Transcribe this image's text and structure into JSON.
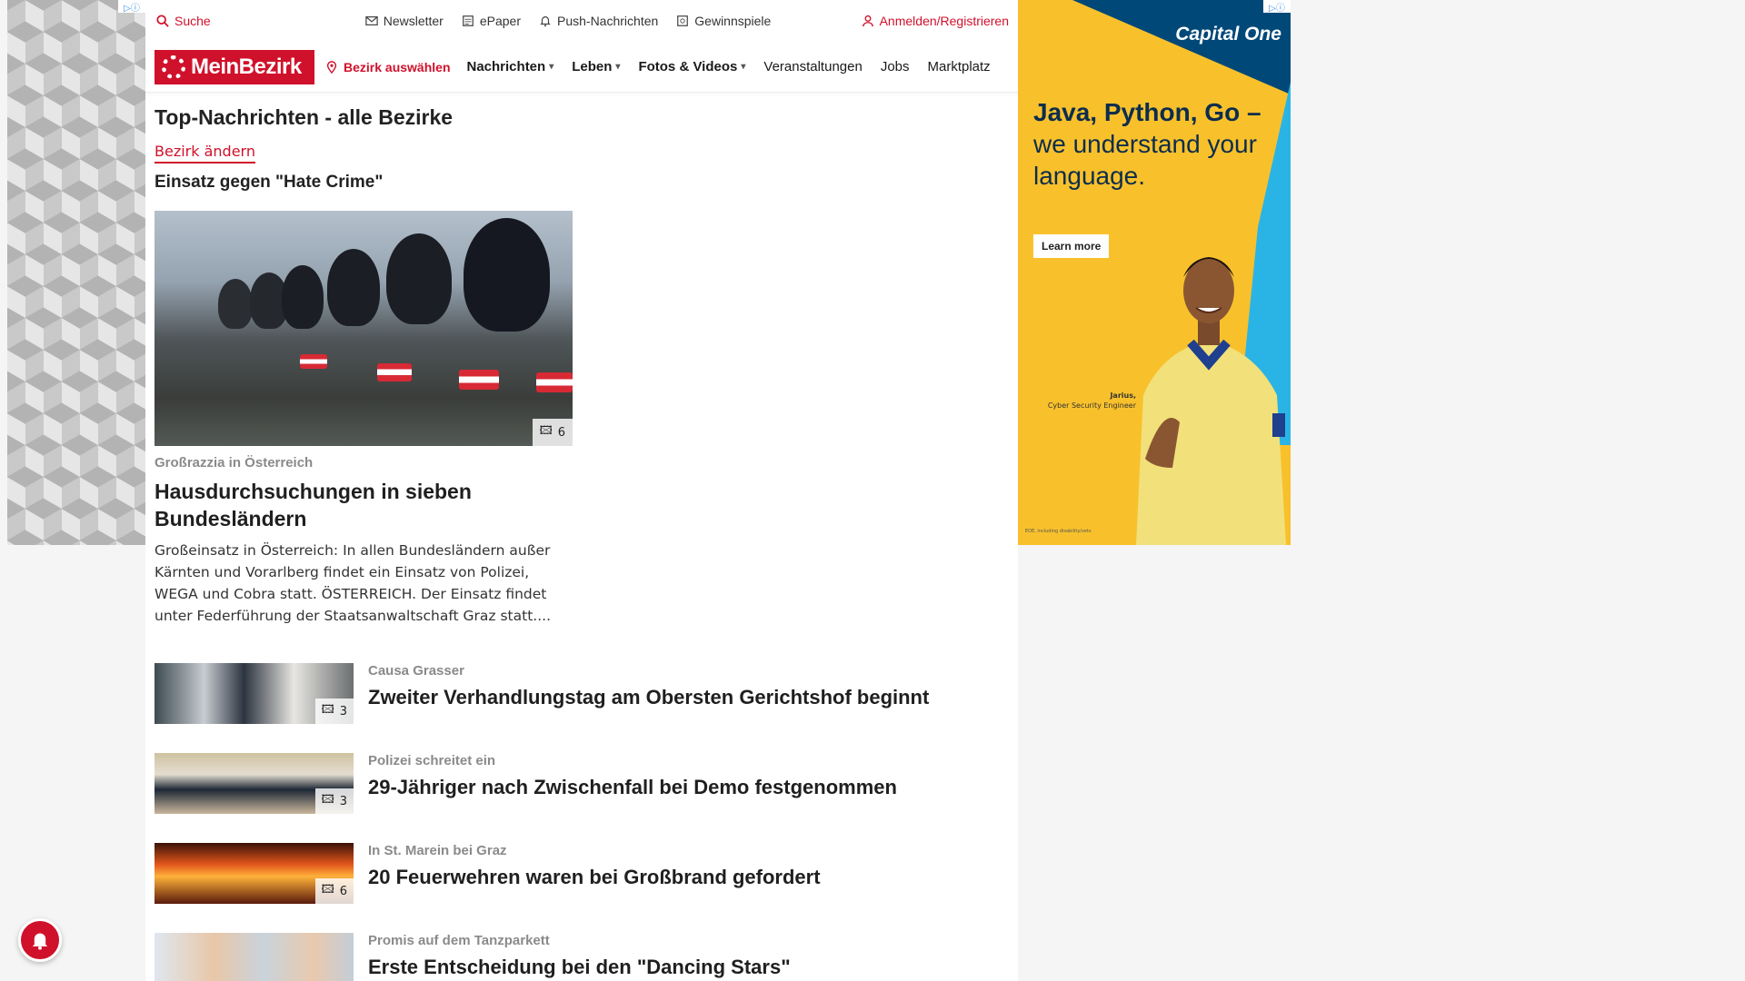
{
  "topbar": {
    "search": "Suche",
    "links": [
      "Newsletter",
      "ePaper",
      "Push-Nachrichten",
      "Gewinnspiele"
    ],
    "login": "Anmelden/Registrieren"
  },
  "nav": {
    "logo": "MeinBezirk",
    "bezirk": "Bezirk auswählen",
    "items": [
      "Nachrichten",
      "Leben",
      "Fotos & Videos",
      "Veranstaltungen",
      "Jobs",
      "Marktplatz"
    ]
  },
  "page": {
    "title": "Top-Nachrichten - alle Bezirke",
    "change": "Bezirk ändern",
    "section": "Einsatz gegen \"Hate Crime\""
  },
  "hero": {
    "photo_count": "6",
    "kicker": "Großrazzia in Österreich",
    "title": "Hausdurchsuchungen in sieben Bundesländern",
    "text": "Großeinsatz in Österreich: In allen Bundesländern außer Kärnten und Vorarlberg findet ein Einsatz von Polizei, WEGA und Cobra statt. ÖSTERREICH. Der Einsatz findet unter Federführung der Staatsanwaltschaft Graz statt...."
  },
  "articles": [
    {
      "kicker": "Causa Grasser",
      "title": "Zweiter Verhandlungstag am Obersten Gerichtshof beginnt",
      "photo_count": "3"
    },
    {
      "kicker": "Polizei schreitet ein",
      "title": "29-Jähriger nach Zwischenfall bei Demo festgenommen",
      "photo_count": "3"
    },
    {
      "kicker": "In St. Marein bei Graz",
      "title": "20 Feuerwehren waren bei Großbrand gefordert",
      "photo_count": "6"
    },
    {
      "kicker": "Promis auf dem Tanzparkett",
      "title": "Erste Entscheidung bei den \"Dancing Stars\"",
      "photo_count": ""
    }
  ],
  "ad": {
    "brand": "Capital One",
    "headline_bold": "Java, Python, Go –",
    "headline_rest": "we understand your language.",
    "cta": "Learn more",
    "caption_name": "Jarius,",
    "caption_role": "Cyber Security Engineer",
    "fine": "EOE, including disability/vets"
  },
  "colors": {
    "brand_red": "#d0112b",
    "ad_yellow": "#f8c12c",
    "ad_navy": "#004878"
  }
}
